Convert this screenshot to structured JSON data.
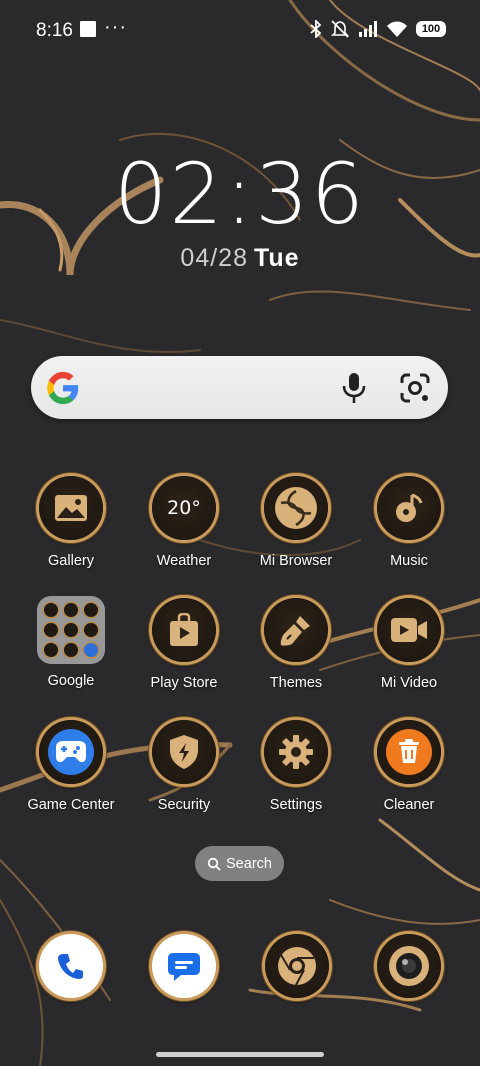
{
  "status_bar": {
    "time": "8:16",
    "overflow": "···",
    "battery": "100",
    "icons": [
      "bluetooth-icon",
      "mute-icon",
      "signal-icon",
      "wifi-icon"
    ]
  },
  "clock": {
    "time": "02:36",
    "date": "04/28",
    "day": "Tue"
  },
  "search_widget": {
    "icons": [
      "google-logo",
      "mic-icon",
      "lens-icon"
    ]
  },
  "apps": {
    "gallery": "Gallery",
    "weather": "Weather",
    "weather_temp": "20°",
    "mi_browser": "Mi Browser",
    "music": "Music",
    "google": "Google",
    "play_store": "Play Store",
    "themes": "Themes",
    "mi_video": "Mi Video",
    "game_center": "Game Center",
    "security": "Security",
    "settings": "Settings",
    "cleaner": "Cleaner"
  },
  "home_search": {
    "label": "Search"
  },
  "dock": [
    "phone-icon",
    "messages-icon",
    "chrome-icon",
    "camera-icon"
  ],
  "colors": {
    "accent_gold": "#c89a5c",
    "cleaner_orange": "#f07a1e",
    "game_blue": "#2f7de8"
  }
}
